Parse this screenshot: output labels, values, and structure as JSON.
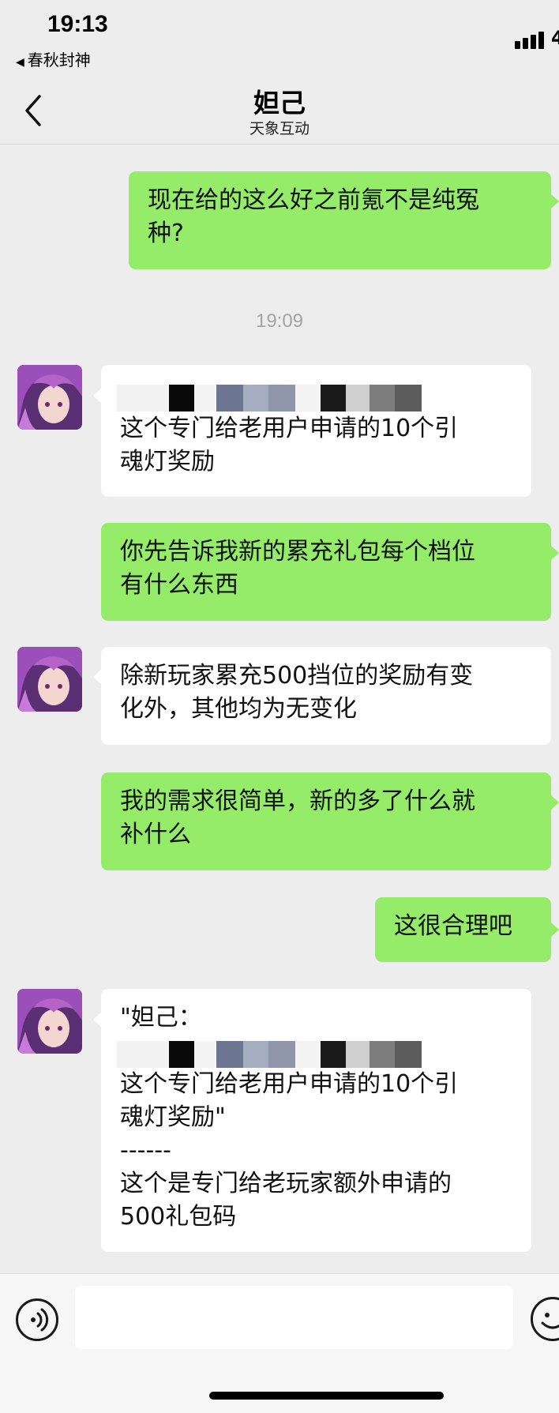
{
  "status_bar": {
    "time": "19:13",
    "back_app": "春秋封神",
    "right_partial": "4"
  },
  "header": {
    "title": "妲己",
    "subtitle": "天象互动"
  },
  "messages": [
    {
      "from": "me",
      "lines": [
        "现在给的这么好之前氪不是纯冤",
        "种?"
      ]
    },
    {
      "timestamp": "19:09"
    },
    {
      "from": "them",
      "lines": [
        "这个专门给老用户申请的10个引",
        "魂灯奖励"
      ]
    },
    {
      "from": "me",
      "lines": [
        "你先告诉我新的累充礼包每个档位",
        "有什么东西"
      ]
    },
    {
      "from": "them",
      "lines": [
        "除新玩家累充500挡位的奖励有变",
        "化外，其他均为无变化"
      ]
    },
    {
      "from": "me",
      "lines": [
        "我的需求很简单，新的多了什么就",
        "补什么"
      ]
    },
    {
      "from": "me",
      "lines": [
        "这很合理吧"
      ]
    },
    {
      "from": "them",
      "lines": [
        "\"妲己：",
        "这个专门给老用户申请的10个引",
        "魂灯奖励\"",
        "------",
        "这个是专门给老玩家额外申请的",
        "500礼包码"
      ]
    }
  ],
  "colors": {
    "me_bubble": "#95ec69",
    "them_bubble": "#ffffff",
    "background": "#ededed"
  },
  "icons": {
    "back": "chevron-left-icon",
    "voice": "voice-icon",
    "emoji": "emoji-icon"
  }
}
